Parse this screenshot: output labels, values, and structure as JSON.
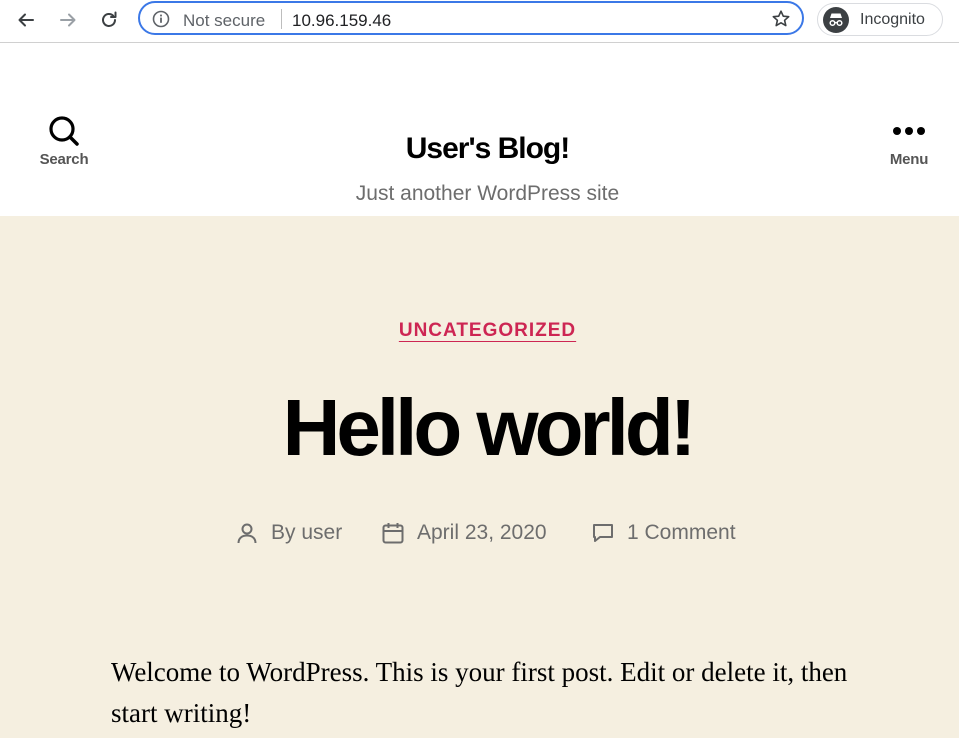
{
  "browser": {
    "security_label": "Not secure",
    "url": "10.96.159.46",
    "incognito_label": "Incognito"
  },
  "header": {
    "search_label": "Search",
    "site_title": "User's Blog!",
    "site_description": "Just another WordPress site",
    "menu_label": "Menu"
  },
  "post": {
    "category": "UNCATEGORIZED",
    "title": "Hello world!",
    "author": "By user",
    "date": "April 23, 2020",
    "comments": "1 Comment",
    "content": "Welcome to WordPress. This is your first post. Edit or delete it, then start writing!"
  },
  "colors": {
    "accent": "#cd2653",
    "post_background": "#f5efe0",
    "omnibox_focus": "#3b78e7"
  }
}
